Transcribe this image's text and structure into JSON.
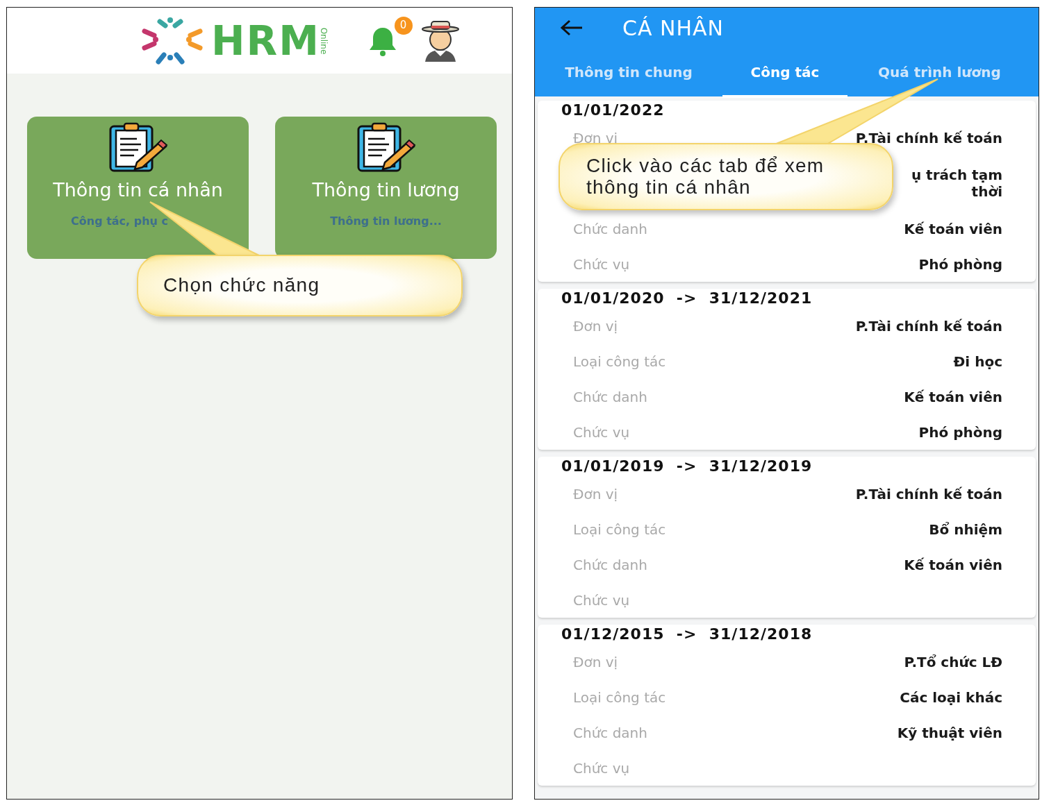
{
  "left_screen": {
    "logo": {
      "text": "HRM",
      "tagline": "Online"
    },
    "notification_count": "0",
    "tiles": [
      {
        "title": "Thông tin cá nhân",
        "subtitle": "Công tác, phụ c"
      },
      {
        "title": "Thông tin lương",
        "subtitle": "Thông tin lương..."
      }
    ],
    "callout": "Chọn chức năng"
  },
  "right_screen": {
    "title": "CÁ NHÂN",
    "tabs": [
      {
        "label": "Thông tin chung",
        "selected": false
      },
      {
        "label": "Công tác",
        "selected": true
      },
      {
        "label": "Quá trình lương",
        "selected": false
      }
    ],
    "records": [
      {
        "period": "01/01/2022",
        "fields": [
          {
            "label": "Đơn vị",
            "value": "P.Tài chính kế toán"
          },
          {
            "value_lines": [
              "ụ trách tạm",
              "thời"
            ]
          },
          {
            "label": "Chức danh",
            "value": "Kế toán viên"
          },
          {
            "label": "Chức vụ",
            "value": "Phó phòng"
          }
        ]
      },
      {
        "period": "01/01/2020  ->  31/12/2021",
        "fields": [
          {
            "label": "Đơn vị",
            "value": "P.Tài chính kế toán"
          },
          {
            "label": "Loại công tác",
            "value": "Đi học"
          },
          {
            "label": "Chức danh",
            "value": "Kế toán viên"
          },
          {
            "label": "Chức vụ",
            "value": "Phó phòng"
          }
        ]
      },
      {
        "period": "01/01/2019  ->  31/12/2019",
        "fields": [
          {
            "label": "Đơn vị",
            "value": "P.Tài chính kế toán"
          },
          {
            "label": "Loại công tác",
            "value": "Bổ nhiệm"
          },
          {
            "label": "Chức danh",
            "value": "Kế toán viên"
          },
          {
            "label": "Chức vụ"
          }
        ]
      },
      {
        "period": "01/12/2015  ->  31/12/2018",
        "fields": [
          {
            "label": "Đơn vị",
            "value": "P.Tổ chức LĐ"
          },
          {
            "label": "Loại công tác",
            "value": "Các loại khác"
          },
          {
            "label": "Chức danh",
            "value": "Kỹ thuật viên"
          },
          {
            "label": "Chức vụ"
          }
        ]
      }
    ],
    "callout_lines": [
      "Click vào các tab để xem",
      "thông tin cá nhân"
    ]
  }
}
